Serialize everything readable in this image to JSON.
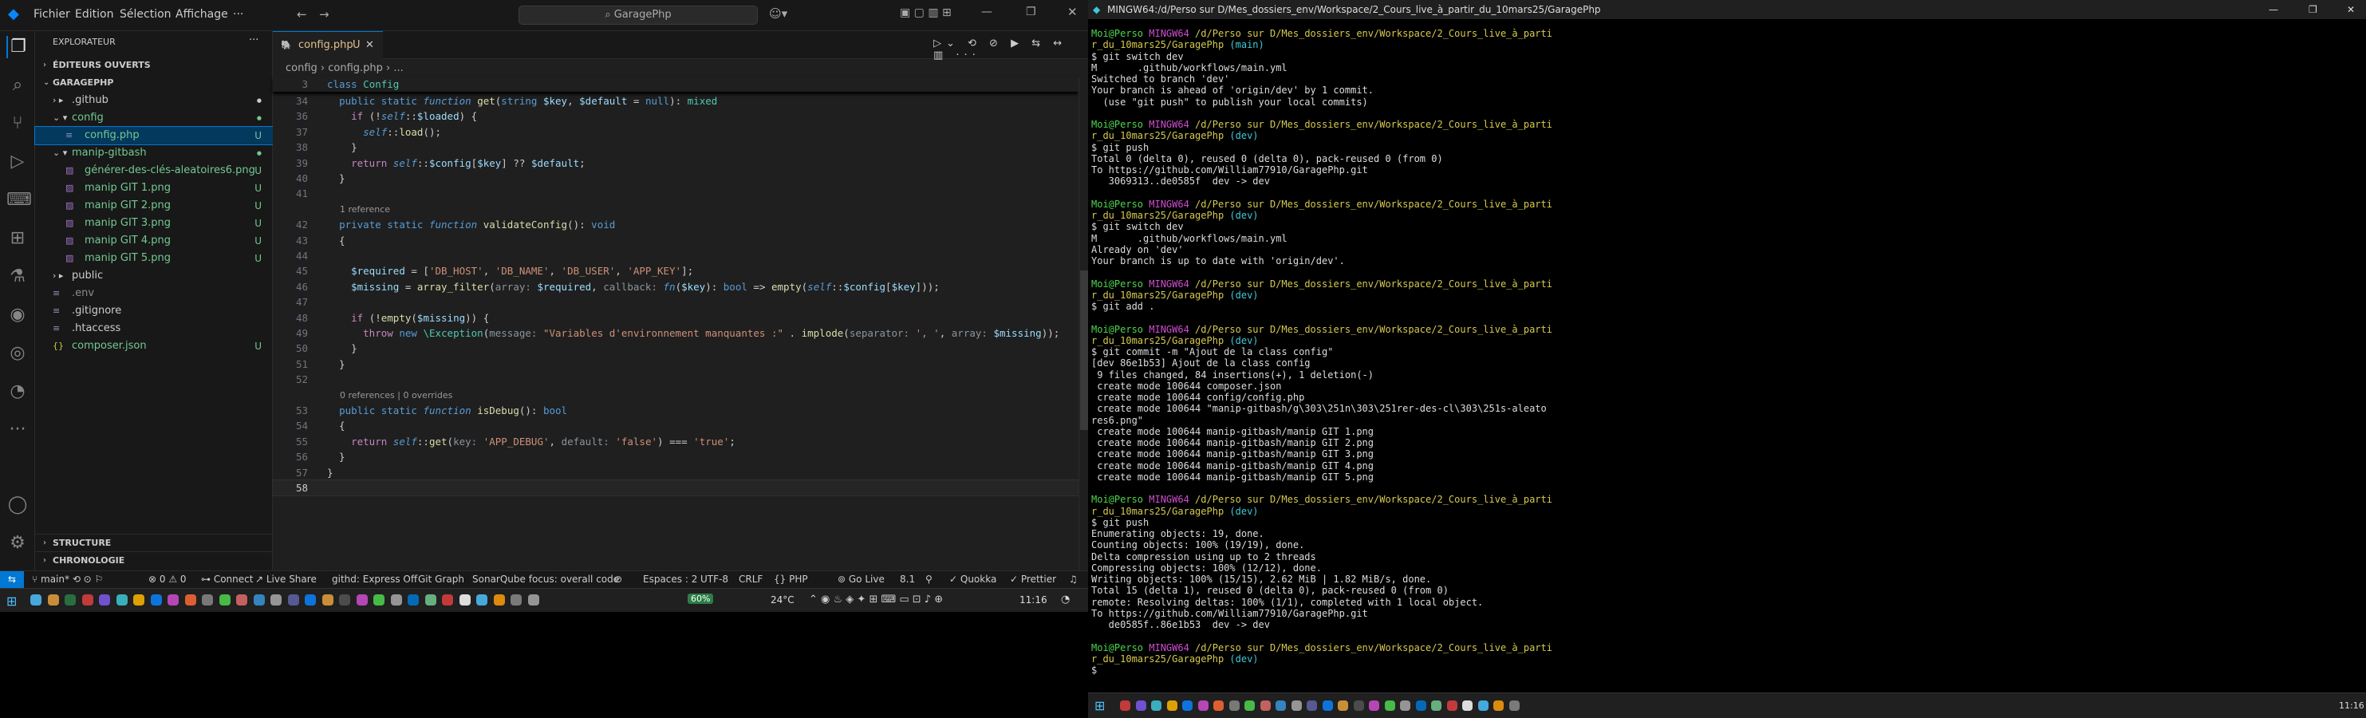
{
  "vscode": {
    "menu": [
      "Fichier",
      "Edition",
      "Sélection",
      "Affichage",
      "···"
    ],
    "search_text": "GaragePhp",
    "explorer_title": "EXPLORATEUR",
    "open_editors": "ÉDITEURS OUVERTS",
    "project": "GARAGEPHP",
    "tree": [
      {
        "label": ".github",
        "status": "",
        "kind": "folder",
        "color": "#cccccc",
        "dot": true
      },
      {
        "label": "config",
        "status": "",
        "kind": "folder-open",
        "color": "#73c991",
        "dot": true
      },
      {
        "label": "config.php",
        "status": "U",
        "kind": "file",
        "color": "#73c991",
        "selected": true
      },
      {
        "label": "manip-gitbash",
        "status": "",
        "kind": "folder-open",
        "color": "#73c991",
        "dot": true
      },
      {
        "label": "générer-des-clés-aleatoires6.png",
        "status": "U",
        "kind": "img",
        "color": "#73c991"
      },
      {
        "label": "manip GIT 1.png",
        "status": "U",
        "kind": "img",
        "color": "#73c991"
      },
      {
        "label": "manip GIT 2.png",
        "status": "U",
        "kind": "img",
        "color": "#73c991"
      },
      {
        "label": "manip GIT 3.png",
        "status": "U",
        "kind": "img",
        "color": "#73c991"
      },
      {
        "label": "manip GIT 4.png",
        "status": "U",
        "kind": "img",
        "color": "#73c991"
      },
      {
        "label": "manip GIT 5.png",
        "status": "U",
        "kind": "img",
        "color": "#73c991"
      },
      {
        "label": "public",
        "status": "",
        "kind": "folder",
        "color": "#cccccc"
      },
      {
        "label": ".env",
        "status": "",
        "kind": "file",
        "color": "#8b8b8b"
      },
      {
        "label": ".gitignore",
        "status": "",
        "kind": "file",
        "color": "#cccccc"
      },
      {
        "label": ".htaccess",
        "status": "",
        "kind": "file",
        "color": "#cccccc"
      },
      {
        "label": "composer.json",
        "status": "U",
        "kind": "json",
        "color": "#73c991"
      }
    ],
    "structure": "STRUCTURE",
    "chronologie": "CHRONOLOGIE",
    "tab_label": "config.php",
    "tab_status": "U",
    "breadcrumb": "config  ›  config.php  ›  ...",
    "sticky": "class Config",
    "code": [
      {
        "n": "3",
        "html": "<span class='kw'>class</span> <span class='ty'>Config</span>"
      },
      {
        "n": "34",
        "html": "  <span class='kw'>public static</span> <span class='kw it'>function</span> <span class='fn'>get</span>(<span class='kw'>string</span> <span class='vr'>$key</span>, <span class='vr'>$default</span> = <span class='kw'>null</span>): <span class='ty'>mixed</span>"
      },
      {
        "n": "36",
        "html": "    <span class='kw2'>if</span> (!<span class='kw it'>self</span>::<span class='vr'>$loaded</span>) {"
      },
      {
        "n": "37",
        "html": "      <span class='kw it'>self</span>::<span class='fn'>load</span>();"
      },
      {
        "n": "38",
        "html": "    }"
      },
      {
        "n": "39",
        "html": "    <span class='kw2'>return</span> <span class='kw it'>self</span>::<span class='vr'>$config</span>[<span class='vr'>$key</span>] ?? <span class='vr'>$default</span>;"
      },
      {
        "n": "40",
        "html": "  }"
      },
      {
        "n": "41",
        "html": ""
      },
      {
        "n": "",
        "html": "",
        "comment": "1 reference"
      },
      {
        "n": "42",
        "html": "  <span class='kw'>private static</span> <span class='kw it'>function</span> <span class='fn'>validateConfig</span>(): <span class='kw'>void</span>"
      },
      {
        "n": "43",
        "html": "  {"
      },
      {
        "n": "44",
        "html": ""
      },
      {
        "n": "45",
        "html": "    <span class='vr'>$required</span> = [<span class='sr'>'DB_HOST'</span>, <span class='sr'>'DB_NAME'</span>, <span class='sr'>'DB_USER'</span>, <span class='sr'>'APP_KEY'</span>];"
      },
      {
        "n": "46",
        "html": "    <span class='vr'>$missing</span> = <span class='fn'>array_filter</span>(<span class='ih'>array:</span> <span class='vr'>$required</span>, <span class='ih'>callback:</span> <span class='kw it'>fn</span>(<span class='vr'>$key</span>): <span class='kw'>bool</span> => <span class='fn'>empty</span>(<span class='kw it'>self</span>::<span class='vr'>$config</span>[<span class='vr'>$key</span>]));"
      },
      {
        "n": "47",
        "html": ""
      },
      {
        "n": "48",
        "html": "    <span class='kw2'>if</span> (!<span class='fn'>empty</span>(<span class='vr'>$missing</span>)) {"
      },
      {
        "n": "49",
        "html": "      <span class='kw2'>throw</span> <span class='kw'>new</span> <span class='ty'>\\Exception</span>(<span class='ih'>message:</span> <span class='sr'>\"Variables d'environnement manquantes :\"</span> . <span class='fn'>implode</span>(<span class='ih'>separator:</span> <span class='sr'>', '</span>, <span class='ih'>array:</span> <span class='vr'>$missing</span>));"
      },
      {
        "n": "50",
        "html": "    }"
      },
      {
        "n": "51",
        "html": "  }"
      },
      {
        "n": "52",
        "html": ""
      },
      {
        "n": "",
        "html": "",
        "comment": "0 references | 0 overrides"
      },
      {
        "n": "53",
        "html": "  <span class='kw'>public static</span> <span class='kw it'>function</span> <span class='fn'>isDebug</span>(): <span class='kw'>bool</span>"
      },
      {
        "n": "54",
        "html": "  {"
      },
      {
        "n": "55",
        "html": "    <span class='kw2'>return</span> <span class='kw it'>self</span>::<span class='fn'>get</span>(<span class='ih'>key:</span> <span class='sr'>'APP_DEBUG'</span>, <span class='ih'>default:</span> <span class='sr'>'false'</span>) === <span class='sr'>'true'</span>;"
      },
      {
        "n": "56",
        "html": "  }"
      },
      {
        "n": "57",
        "html": "}"
      },
      {
        "n": "58",
        "html": ""
      }
    ],
    "status": {
      "branch": "main*",
      "errors": "⊗ 0 ⚠ 0",
      "connect": "Connect",
      "liveshare": "Live Share",
      "githd": "githd: Express Off",
      "gitgraph": "Git Graph",
      "sonar": "SonarQube focus: overall code",
      "spaces": "Espaces : 2",
      "encoding": "UTF-8",
      "eol": "CRLF",
      "lang": "PHP",
      "golive": "Go Live",
      "version": "8.1",
      "quokka": "Quokka",
      "prettier": "Prettier"
    },
    "taskbar": {
      "battery": "60%",
      "temp": "24°C",
      "time": "11:16"
    }
  },
  "terminal": {
    "title": "MINGW64:/d/Perso sur D/Mes_dossiers_env/Workspace/2_Cours_live_à_partir_du_10mars25/GaragePhp",
    "time2": "11:16",
    "lines": [
      [
        [
          "g",
          "Moi@Perso "
        ],
        [
          "m",
          "MINGW64 "
        ],
        [
          "y",
          "/d/Perso sur D/Mes_dossiers_env/Workspace/2_Cours_live_à_parti"
        ]
      ],
      [
        [
          "y",
          "r_du_10mars25/GaragePhp "
        ],
        [
          "c",
          "(main)"
        ]
      ],
      [
        [
          "",
          "$ git switch dev"
        ]
      ],
      [
        [
          "",
          "M       .github/workflows/main.yml"
        ]
      ],
      [
        [
          "",
          "Switched to branch 'dev'"
        ]
      ],
      [
        [
          "",
          "Your branch is ahead of 'origin/dev' by 1 commit."
        ]
      ],
      [
        [
          "",
          "  (use \"git push\" to publish your local commits)"
        ]
      ],
      [
        [
          "",
          ""
        ]
      ],
      [
        [
          "g",
          "Moi@Perso "
        ],
        [
          "m",
          "MINGW64 "
        ],
        [
          "y",
          "/d/Perso sur D/Mes_dossiers_env/Workspace/2_Cours_live_à_parti"
        ]
      ],
      [
        [
          "y",
          "r_du_10mars25/GaragePhp "
        ],
        [
          "c",
          "(dev)"
        ]
      ],
      [
        [
          "",
          "$ git push"
        ]
      ],
      [
        [
          "",
          "Total 0 (delta 0), reused 0 (delta 0), pack-reused 0 (from 0)"
        ]
      ],
      [
        [
          "",
          "To https://github.com/William77910/GaragePhp.git"
        ]
      ],
      [
        [
          "",
          "   3069313..de0585f  dev -> dev"
        ]
      ],
      [
        [
          "",
          ""
        ]
      ],
      [
        [
          "g",
          "Moi@Perso "
        ],
        [
          "m",
          "MINGW64 "
        ],
        [
          "y",
          "/d/Perso sur D/Mes_dossiers_env/Workspace/2_Cours_live_à_parti"
        ]
      ],
      [
        [
          "y",
          "r_du_10mars25/GaragePhp "
        ],
        [
          "c",
          "(dev)"
        ]
      ],
      [
        [
          "",
          "$ git switch dev"
        ]
      ],
      [
        [
          "",
          "M       .github/workflows/main.yml"
        ]
      ],
      [
        [
          "",
          "Already on 'dev'"
        ]
      ],
      [
        [
          "",
          "Your branch is up to date with 'origin/dev'."
        ]
      ],
      [
        [
          "",
          ""
        ]
      ],
      [
        [
          "g",
          "Moi@Perso "
        ],
        [
          "m",
          "MINGW64 "
        ],
        [
          "y",
          "/d/Perso sur D/Mes_dossiers_env/Workspace/2_Cours_live_à_parti"
        ]
      ],
      [
        [
          "y",
          "r_du_10mars25/GaragePhp "
        ],
        [
          "c",
          "(dev)"
        ]
      ],
      [
        [
          "",
          "$ git add ."
        ]
      ],
      [
        [
          "",
          ""
        ]
      ],
      [
        [
          "g",
          "Moi@Perso "
        ],
        [
          "m",
          "MINGW64 "
        ],
        [
          "y",
          "/d/Perso sur D/Mes_dossiers_env/Workspace/2_Cours_live_à_parti"
        ]
      ],
      [
        [
          "y",
          "r_du_10mars25/GaragePhp "
        ],
        [
          "c",
          "(dev)"
        ]
      ],
      [
        [
          "",
          "$ git commit -m \"Ajout de la class config\""
        ]
      ],
      [
        [
          "",
          "[dev 86e1b53] Ajout de la class config"
        ]
      ],
      [
        [
          "",
          " 9 files changed, 84 insertions(+), 1 deletion(-)"
        ]
      ],
      [
        [
          "",
          " create mode 100644 composer.json"
        ]
      ],
      [
        [
          "",
          " create mode 100644 config/config.php"
        ]
      ],
      [
        [
          "",
          " create mode 100644 \"manip-gitbash/g\\303\\251n\\303\\251rer-des-cl\\303\\251s-aleato"
        ]
      ],
      [
        [
          "",
          "res6.png\""
        ]
      ],
      [
        [
          "",
          ""
        ]
      ],
      [
        [
          "",
          ""
        ]
      ],
      [
        [
          "",
          ""
        ]
      ],
      [
        [
          "",
          ""
        ]
      ],
      [
        [
          "",
          ""
        ]
      ],
      [
        [
          "",
          ""
        ]
      ],
      [
        [
          "",
          ""
        ]
      ],
      [
        [
          "",
          ""
        ]
      ],
      [
        [
          "",
          ""
        ]
      ],
      [
        [
          "",
          ""
        ]
      ],
      [
        [
          "",
          ""
        ]
      ],
      [
        [
          "",
          ""
        ]
      ],
      [
        [
          "",
          ""
        ]
      ],
      [
        [
          "",
          ""
        ]
      ],
      [
        [
          "",
          ""
        ]
      ],
      [
        [
          "",
          ""
        ]
      ],
      [
        [
          "",
          ""
        ]
      ],
      [
        [
          "",
          ""
        ]
      ],
      [
        [
          "",
          ""
        ]
      ],
      [
        [
          "",
          ""
        ]
      ],
      [
        [
          "",
          ""
        ]
      ],
      [
        [
          "",
          ""
        ]
      ],
      [
        [
          "",
          ""
        ]
      ]
    ],
    "lines_b": [
      [
        [
          "g",
          "Moi@Perso "
        ],
        [
          "m",
          "MINGW64 "
        ],
        [
          "y",
          "/d/Perso sur D/Mes_dossiers_env/Workspace/2_Cours_live_à_parti"
        ]
      ],
      [
        [
          "y",
          "r_du_10mars25/GaragePhp "
        ],
        [
          "c",
          "(dev)"
        ]
      ],
      [
        [
          "",
          "$ git commit -m \"Ajout de la class config\""
        ]
      ],
      [
        [
          "",
          "[dev 86e1b53] Ajout de la class config"
        ]
      ],
      [
        [
          "",
          ""
        ]
      ]
    ],
    "mode_lines": [
      " create mode 100644 manip-gitbash/manip GIT 1.png",
      " create mode 100644 manip-gitbash/manip GIT 2.png",
      " create mode 100644 manip-gitbash/manip GIT 3.png",
      " create mode 100644 manip-gitbash/manip GIT 4.png",
      " create mode 100644 manip-gitbash/manip GIT 5.png"
    ],
    "push2": [
      [
        [
          "",
          ""
        ]
      ],
      [
        [
          "g",
          "Moi@Perso "
        ],
        [
          "m",
          "MINGW64 "
        ],
        [
          "y",
          "/d/Perso sur D/Mes_dossiers_env/Workspace/2_Cours_live_à_parti"
        ]
      ],
      [
        [
          "y",
          "r_du_10mars25/GaragePhp "
        ],
        [
          "c",
          "(dev)"
        ]
      ],
      [
        [
          "",
          "$ git push"
        ]
      ],
      [
        [
          "",
          "Enumerating objects: 19, done."
        ]
      ],
      [
        [
          "",
          "Counting objects: 100% (19/19), done."
        ]
      ],
      [
        [
          "",
          "Delta compression using up to 2 threads"
        ]
      ],
      [
        [
          "",
          "Compressing objects: 100% (12/12), done."
        ]
      ],
      [
        [
          "",
          "Writing objects: 100% (15/15), 2.62 MiB | 1.82 MiB/s, done."
        ]
      ],
      [
        [
          "",
          "Total 15 (delta 1), reused 0 (delta 0), pack-reused 0 (from 0)"
        ]
      ],
      [
        [
          "",
          "remote: Resolving deltas: 100% (1/1), completed with 1 local object."
        ]
      ],
      [
        [
          "",
          "To https://github.com/William77910/GaragePhp.git"
        ]
      ],
      [
        [
          "",
          "   de0585f..86e1b53  dev -> dev"
        ]
      ],
      [
        [
          "",
          ""
        ]
      ],
      [
        [
          "g",
          "Moi@Perso "
        ],
        [
          "m",
          "MINGW64 "
        ],
        [
          "y",
          "/d/Perso sur D/Mes_dossiers_env/Workspace/2_Cours_live_à_parti"
        ]
      ],
      [
        [
          "y",
          "r_du_10mars25/GaragePhp "
        ],
        [
          "c",
          "(dev)"
        ]
      ],
      [
        [
          "",
          "$ "
        ]
      ]
    ]
  }
}
